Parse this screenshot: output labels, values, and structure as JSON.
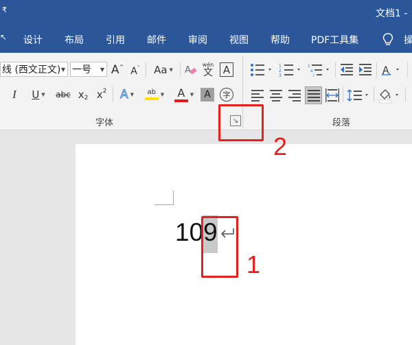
{
  "window": {
    "title": "文档1 -",
    "qa_dropdown": "₹"
  },
  "tabs": {
    "start_partial": "↖",
    "items": [
      "设计",
      "布局",
      "引用",
      "邮件",
      "审阅",
      "视图",
      "帮助",
      "PDF工具集"
    ],
    "end_partial": "操"
  },
  "ribbon": {
    "font_group": {
      "font_name": "线 (西文正文)",
      "font_size": "一号",
      "grow_font": "A",
      "shrink_font": "A",
      "change_case": "Aa",
      "phonetic_top": "wén",
      "phonetic_bottom": "文",
      "char_border": "A",
      "italic": "I",
      "underline": "U",
      "strikethrough": "abc",
      "subscript": "x",
      "subscript_mark": "2",
      "superscript": "x",
      "superscript_mark": "2",
      "text_effects": "A",
      "highlight_text": "ab",
      "font_color": "A",
      "char_shading": "A",
      "enclose_char": "字",
      "label": "字体",
      "dialog_launcher": "↘"
    },
    "paragraph_group": {
      "label": "段落"
    },
    "colors": {
      "highlight": "#ffe000",
      "font_color": "#e81b1b"
    }
  },
  "document": {
    "text_before": "10",
    "selected_char": "9",
    "paragraph_mark": "↵"
  },
  "annotations": {
    "label_1": "1",
    "label_2": "2"
  }
}
